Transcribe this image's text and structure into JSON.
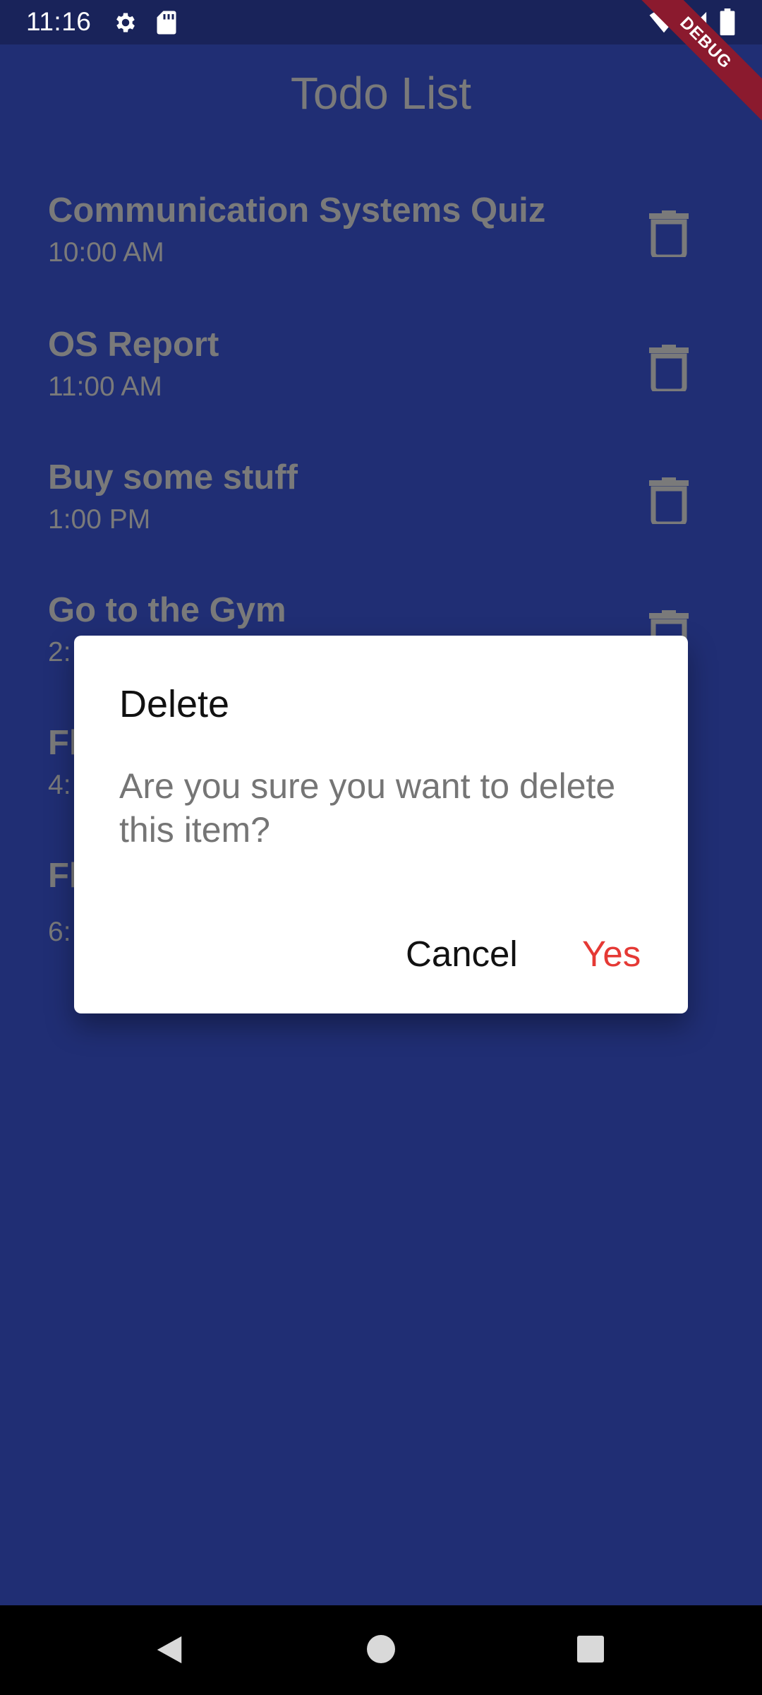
{
  "status_bar": {
    "time": "11:16",
    "icons": [
      "settings-gear-icon",
      "sd-card-icon",
      "wifi-icon",
      "signal-icon",
      "battery-icon"
    ]
  },
  "debug_banner": "DEBUG",
  "app": {
    "title": "Todo List",
    "items": [
      {
        "title": "Communication Systems Quiz",
        "time": "10:00 AM"
      },
      {
        "title": "OS Report",
        "time": "11:00 AM"
      },
      {
        "title": "Buy some stuff",
        "time": "1:00 PM"
      },
      {
        "title": "Go to the Gym",
        "time": "2:"
      },
      {
        "title": "Fl",
        "time": "4:"
      },
      {
        "title": "Fl",
        "time": "6:"
      }
    ]
  },
  "dialog": {
    "title": "Delete",
    "message": "Are you sure you want to delete this item?",
    "cancel_label": "Cancel",
    "confirm_label": "Yes",
    "confirm_color": "#e53935"
  },
  "colors": {
    "background": "#202e74",
    "status_bar": "#19235a",
    "muted_text": "#7a7a7a"
  }
}
